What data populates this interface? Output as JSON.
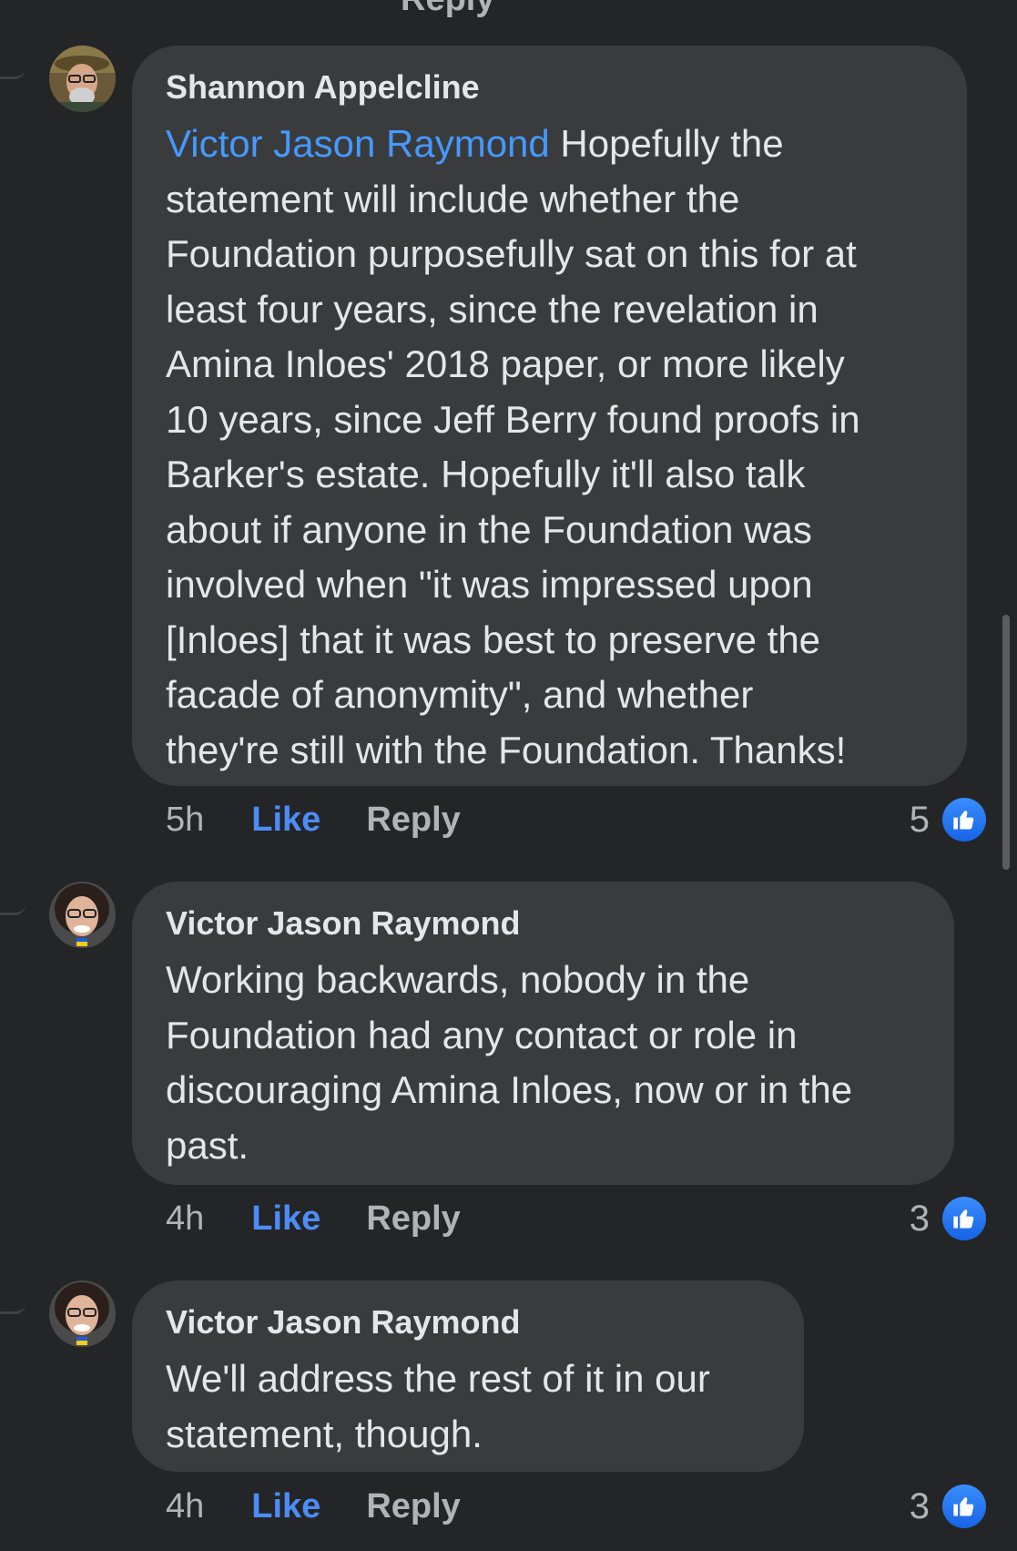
{
  "top_clipped_text": "Reply",
  "comments": [
    {
      "author": "Shannon Appelcline",
      "mention": "Victor Jason Raymond",
      "text_lines": [
        " Hopefully the",
        "statement will include whether the",
        "Foundation purposefully sat on this for at",
        "least four years, since the revelation in",
        "Amina Inloes' 2018 paper, or more likely",
        "10 years, since Jeff Berry found proofs in",
        "Barker's estate. Hopefully it'll also talk",
        "about if anyone in the Foundation was",
        "involved when \"it was impressed upon",
        "[Inloes] that it was best to preserve the",
        "facade of anonymity\", and whether",
        "they're still with the Foundation. Thanks!"
      ],
      "time": "5h",
      "like_label": "Like",
      "reply_label": "Reply",
      "reaction_count": "5",
      "reaction_icon": "thumbs-up-icon"
    },
    {
      "author": "Victor Jason Raymond",
      "text_lines": [
        "Working backwards, nobody in the",
        "Foundation had any contact or role in",
        "discouraging Amina Inloes, now or in the",
        "past."
      ],
      "time": "4h",
      "like_label": "Like",
      "reply_label": "Reply",
      "reaction_count": "3",
      "reaction_icon": "thumbs-up-icon"
    },
    {
      "author": "Victor Jason Raymond",
      "text_lines": [
        "We'll address the rest of it in our",
        "statement, though."
      ],
      "time": "4h",
      "like_label": "Like",
      "reply_label": "Reply",
      "reaction_count": "3",
      "reaction_icon": "thumbs-up-icon"
    }
  ],
  "colors": {
    "background": "#242526",
    "bubble": "#3a3b3c",
    "mention": "#4599ff",
    "like": "#4c8cf7",
    "secondary_text": "#b0b3b8"
  }
}
